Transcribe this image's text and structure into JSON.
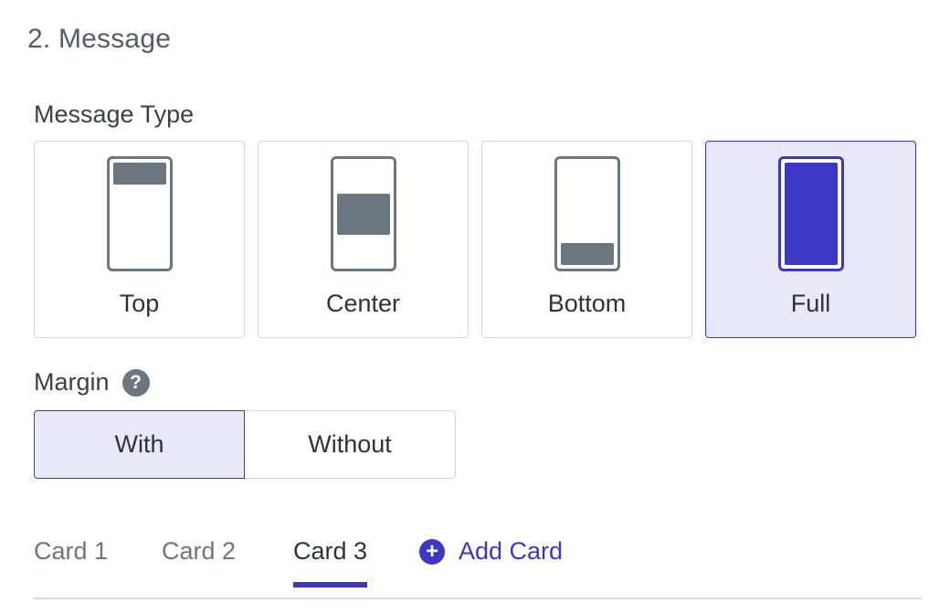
{
  "section": {
    "title": "2. Message"
  },
  "message_type": {
    "label": "Message Type",
    "options": [
      {
        "label": "Top",
        "icon": "phone-top-icon",
        "selected": false
      },
      {
        "label": "Center",
        "icon": "phone-center-icon",
        "selected": false
      },
      {
        "label": "Bottom",
        "icon": "phone-bottom-icon",
        "selected": false
      },
      {
        "label": "Full",
        "icon": "phone-full-icon",
        "selected": true
      }
    ]
  },
  "margin": {
    "label": "Margin",
    "help_icon": "?",
    "options": [
      {
        "label": "With",
        "selected": true
      },
      {
        "label": "Without",
        "selected": false
      }
    ]
  },
  "tabs": {
    "items": [
      {
        "label": "Card 1",
        "active": false
      },
      {
        "label": "Card 2",
        "active": false
      },
      {
        "label": "Card 3",
        "active": true
      }
    ],
    "add_label": "Add Card",
    "add_icon": "+"
  },
  "colors": {
    "accent": "#3c37c5",
    "selected_bg": "#e9e8f8",
    "icon_gray": "#6b767e"
  }
}
